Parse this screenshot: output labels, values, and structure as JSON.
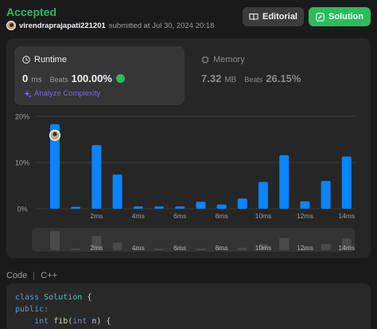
{
  "submission": {
    "status": "Accepted",
    "username": "virendraprajapati221201",
    "submitted_text": "submitted at Jul 30, 2024 20:18"
  },
  "buttons": {
    "editorial": "Editorial",
    "solution": "Solution"
  },
  "runtime": {
    "title": "Runtime",
    "value": "0",
    "unit": "ms",
    "beats_label": "Beats",
    "beats_pct": "100.00%",
    "analyze": "Analyze Complexity"
  },
  "memory": {
    "title": "Memory",
    "value": "7.32",
    "unit": "MB",
    "beats_label": "Beats",
    "beats_pct": "26.15%"
  },
  "chart_data": {
    "type": "bar",
    "x": [
      0,
      1,
      2,
      3,
      4,
      5,
      6,
      7,
      8,
      9,
      10,
      11,
      12,
      13,
      14
    ],
    "values": [
      18.3,
      0.4,
      13.8,
      7.4,
      0.5,
      0.5,
      0.5,
      1.5,
      0.9,
      2.2,
      5.8,
      11.6,
      1.6,
      6.0,
      11.3
    ],
    "overview_values": [
      18.3,
      0.4,
      13.8,
      7.4,
      0.5,
      0.5,
      0.5,
      1.5,
      0.9,
      2.2,
      5.8,
      11.6,
      1.6,
      6.0,
      11.3
    ],
    "y_ticks": [
      "0%",
      "10%",
      "20%"
    ],
    "ylim": [
      0,
      20
    ],
    "x_tick_labels": [
      {
        "x": 2,
        "label": "2ms"
      },
      {
        "x": 4,
        "label": "4ms"
      },
      {
        "x": 6,
        "label": "6ms"
      },
      {
        "x": 8,
        "label": "8ms"
      },
      {
        "x": 10,
        "label": "10ms"
      },
      {
        "x": 12,
        "label": "12ms"
      },
      {
        "x": 14,
        "label": "14ms"
      }
    ],
    "highlight_index": 0,
    "bar_color": "#0a84ff",
    "overview_bar_color": "#4a4a4a",
    "grid": true
  },
  "code": {
    "language_tab": "Code",
    "language": "C++",
    "lines": [
      "class Solution {",
      "public:",
      "    int fib(int n) {"
    ]
  },
  "colors": {
    "accent_green": "#2cbb5d",
    "bar_blue": "#0a84ff",
    "analyze_purple": "#7b61ff"
  }
}
